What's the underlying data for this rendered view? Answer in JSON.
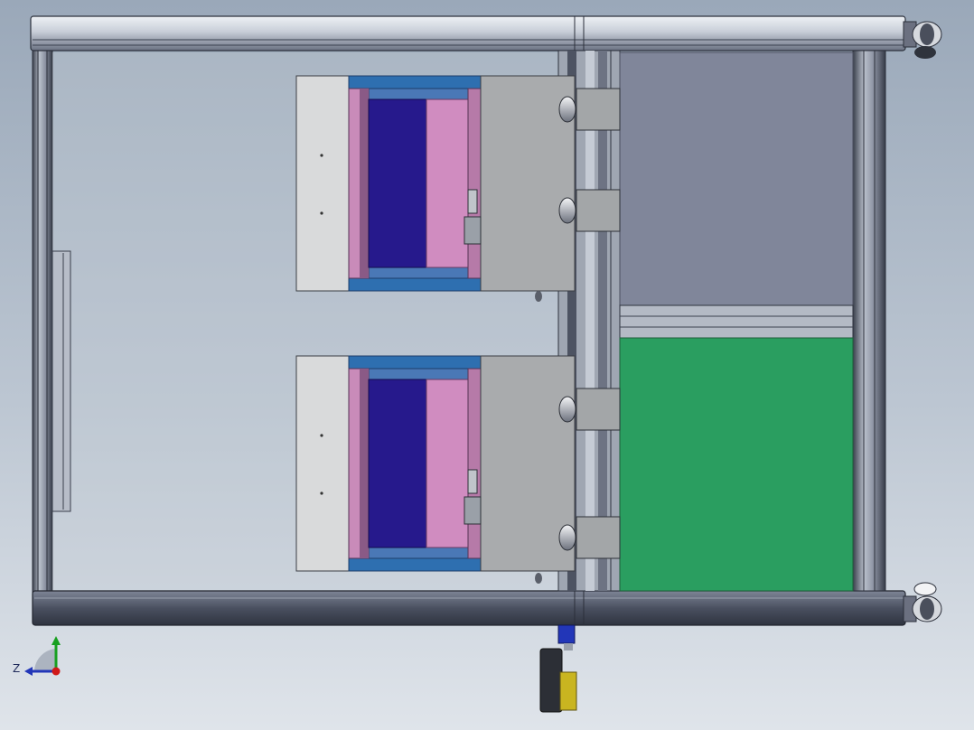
{
  "viewport": {
    "background_top": "#9aa8b9",
    "background_bottom": "#dfe4ea"
  },
  "model": {
    "frame_color": "#3d4350",
    "frame_light": "#c9ced8",
    "panel_gray": "#80869a",
    "panel_green": "#2a9e60",
    "drawer_blue": "#26198c",
    "drawer_pink": "#d08cc0",
    "drawer_rail": "#2e6fb0",
    "cover_gray": "#a9abad",
    "cover_light": "#d9dadb"
  },
  "triad": {
    "z_label": "Z",
    "y_color": "#18a020",
    "z_color": "#2236b8",
    "x_color": "#d01818"
  }
}
